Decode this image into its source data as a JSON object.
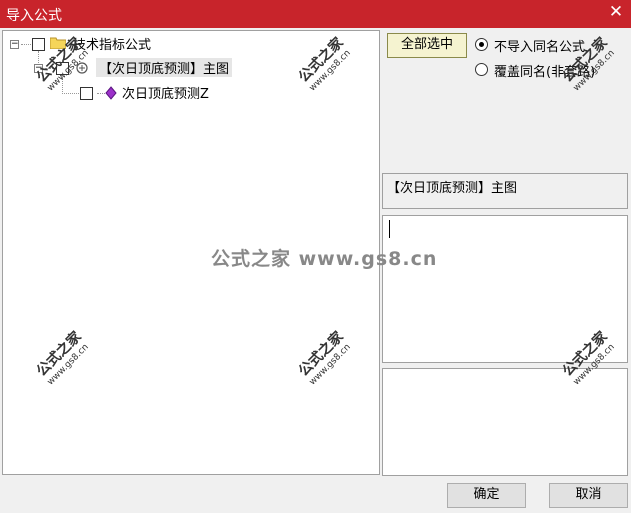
{
  "window": {
    "title": "导入公式",
    "close_glyph": "✕"
  },
  "tree": {
    "root_label": "技术指标公式",
    "child_label": "【次日顶底预测】主图",
    "leaf_label": "次日顶底预测Z"
  },
  "options": {
    "select_all_label": "全部选中",
    "radio_skip_label": "不导入同名公式",
    "radio_overwrite_label": "覆盖同名(非套路)"
  },
  "detail": {
    "name": "【次日顶底预测】主图"
  },
  "watermark": {
    "cn": "公式之家",
    "url": "www.gs8.cn",
    "center": "公式之家 www.gs8.cn"
  },
  "footer": {
    "ok_label": "确定",
    "cancel_label": "取消"
  }
}
